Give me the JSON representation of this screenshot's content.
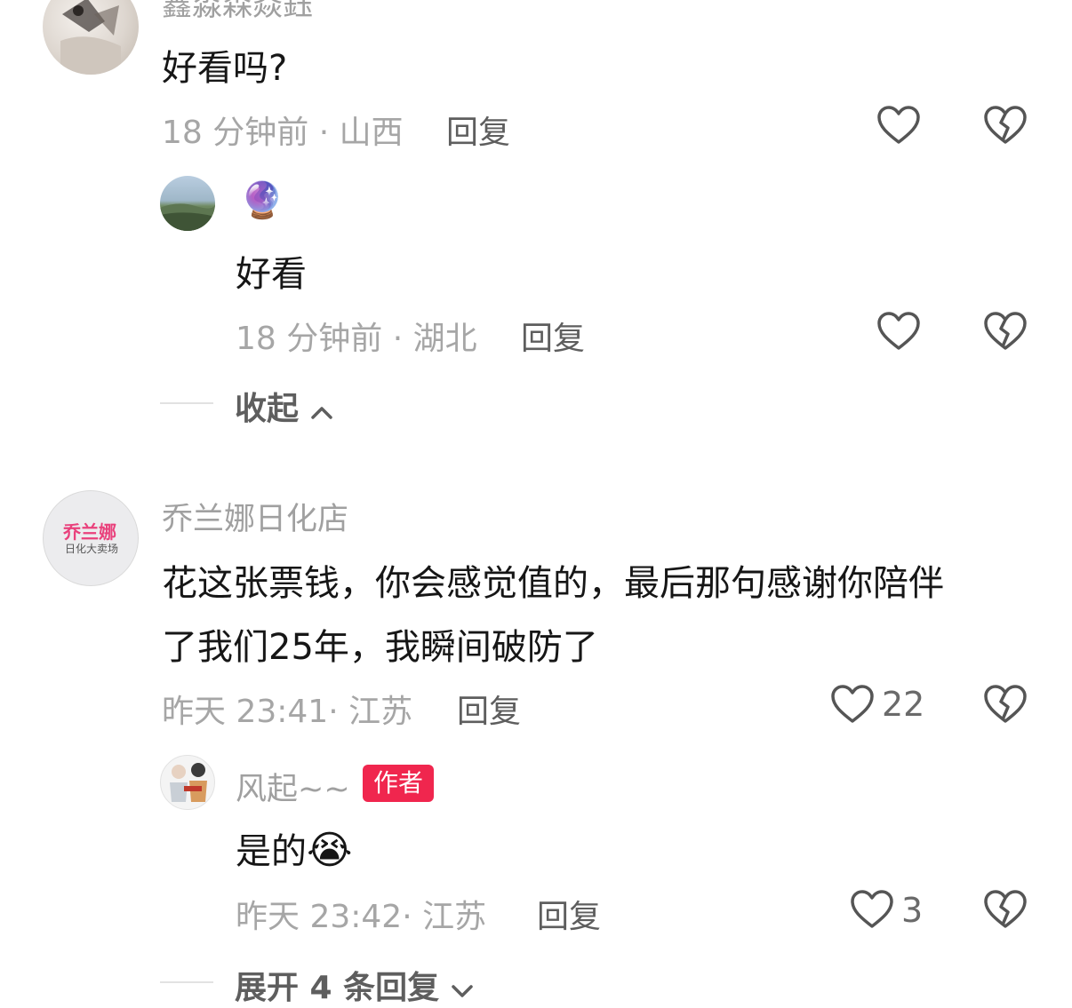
{
  "comments": [
    {
      "username": "鑫淼森焱鈺",
      "text": "好看吗?",
      "meta": "18 分钟前 · 山西",
      "reply_label": "回复",
      "like_count": "",
      "replies": [
        {
          "username_emoji": "🔮",
          "text": "好看",
          "meta": "18 分钟前 · 湖北",
          "reply_label": "回复",
          "like_count": ""
        }
      ],
      "toggle_label": "收起"
    },
    {
      "username": "乔兰娜日化店",
      "avatar_text_main": "乔兰娜",
      "avatar_text_sub": "日化大卖场",
      "text_line1": "花这张票钱，你会感觉值的，最后那句感谢你陪伴",
      "text_line2": "了我们25年，我瞬间破防了",
      "meta": "昨天 23:41· 江苏",
      "reply_label": "回复",
      "like_count": "22",
      "replies": [
        {
          "username": "风起~~",
          "badge": "作者",
          "text": "是的",
          "text_emoji": "😭",
          "meta": "昨天 23:42· 江苏",
          "reply_label": "回复",
          "like_count": "3"
        }
      ],
      "toggle_label": "展开 4 条回复"
    }
  ],
  "colors": {
    "badge_bg": "#f0264e",
    "text_primary": "#161616",
    "text_secondary": "#a6a6a6"
  }
}
